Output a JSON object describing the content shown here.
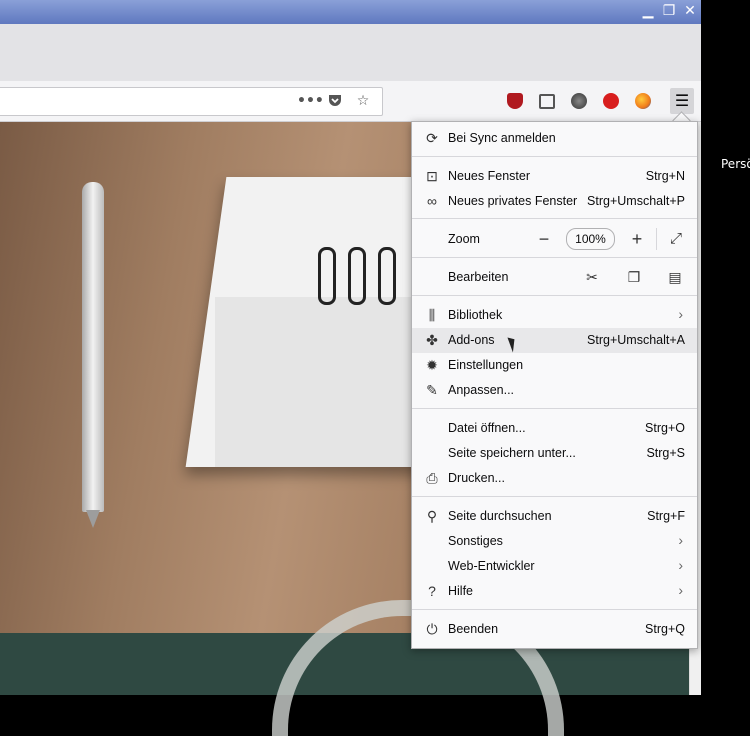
{
  "window": {
    "buttons": [
      "minimize",
      "restore",
      "close"
    ]
  },
  "toolbar": {
    "url_actions": [
      "page-actions-icon",
      "pocket-icon",
      "bookmark-star-icon"
    ],
    "extensions": [
      "ublock-icon",
      "sidebar-icon",
      "ext-gray-icon",
      "abp-icon",
      "firefox-icon"
    ],
    "menu_icon": "hamburger-icon"
  },
  "side_text": "Persö",
  "menu": {
    "sync": "Bei Sync anmelden",
    "new_window": {
      "label": "Neues Fenster",
      "shortcut": "Strg+N"
    },
    "private_window": {
      "label": "Neues privates Fenster",
      "shortcut": "Strg+Umschalt+P"
    },
    "zoom": {
      "label": "Zoom",
      "value": "100%"
    },
    "edit": {
      "label": "Bearbeiten"
    },
    "library": {
      "label": "Bibliothek"
    },
    "addons": {
      "label": "Add-ons",
      "shortcut": "Strg+Umschalt+A"
    },
    "settings": {
      "label": "Einstellungen"
    },
    "customize": {
      "label": "Anpassen..."
    },
    "open_file": {
      "label": "Datei öffnen...",
      "shortcut": "Strg+O"
    },
    "save_page": {
      "label": "Seite speichern unter...",
      "shortcut": "Strg+S"
    },
    "print": {
      "label": "Drucken..."
    },
    "find": {
      "label": "Seite durchsuchen",
      "shortcut": "Strg+F"
    },
    "more": {
      "label": "Sonstiges"
    },
    "webdev": {
      "label": "Web-Entwickler"
    },
    "help": {
      "label": "Hilfe"
    },
    "quit": {
      "label": "Beenden",
      "shortcut": "Strg+Q"
    }
  }
}
